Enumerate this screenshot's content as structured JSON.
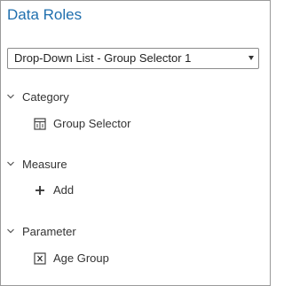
{
  "panel": {
    "title": "Data Roles",
    "object_select": {
      "value": "Drop-Down List - Group Selector 1",
      "icon": "chevron-down-icon"
    },
    "sections": [
      {
        "label": "Category",
        "icon": "chevron-down-icon",
        "items": [
          {
            "label": "Group Selector",
            "icon": "category-icon"
          }
        ]
      },
      {
        "label": "Measure",
        "icon": "chevron-down-icon",
        "items": [
          {
            "label": "Add",
            "icon": "plus-icon"
          }
        ]
      },
      {
        "label": "Parameter",
        "icon": "chevron-down-icon",
        "items": [
          {
            "label": "Age Group",
            "icon": "parameter-icon"
          }
        ]
      }
    ]
  },
  "colors": {
    "title": "#1f6fae",
    "text": "#333333",
    "border": "#9a9a9a"
  }
}
